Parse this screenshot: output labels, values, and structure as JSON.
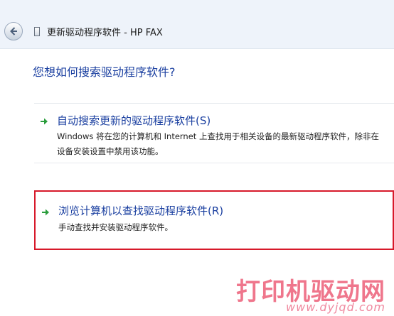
{
  "titlebar": {
    "title": "更新驱动程序软件 - HP FAX",
    "back_icon": "back-arrow-icon",
    "device_icon": "device-icon"
  },
  "question": "您想如何搜索驱动程序软件?",
  "options": [
    {
      "title": "自动搜索更新的驱动程序软件(S)",
      "description": "Windows 将在您的计算机和 Internet 上查找用于相关设备的最新驱动程序软件，除非在设备安装设置中禁用该功能。",
      "icon": "green-arrow-icon"
    },
    {
      "title": "浏览计算机以查找驱动程序软件(R)",
      "description": "手动查找并安装驱动程序软件。",
      "icon": "green-arrow-icon",
      "highlighted": true,
      "highlight_color": "#d7192a"
    }
  ],
  "watermark": {
    "text": "打印机驱动网",
    "url": "www.dyjqd.com"
  },
  "colors": {
    "link_blue": "#1a3fa0",
    "arrow_green": "#2a9d3c",
    "highlight_red": "#d7192a",
    "watermark_pink": "#ee6b83"
  }
}
